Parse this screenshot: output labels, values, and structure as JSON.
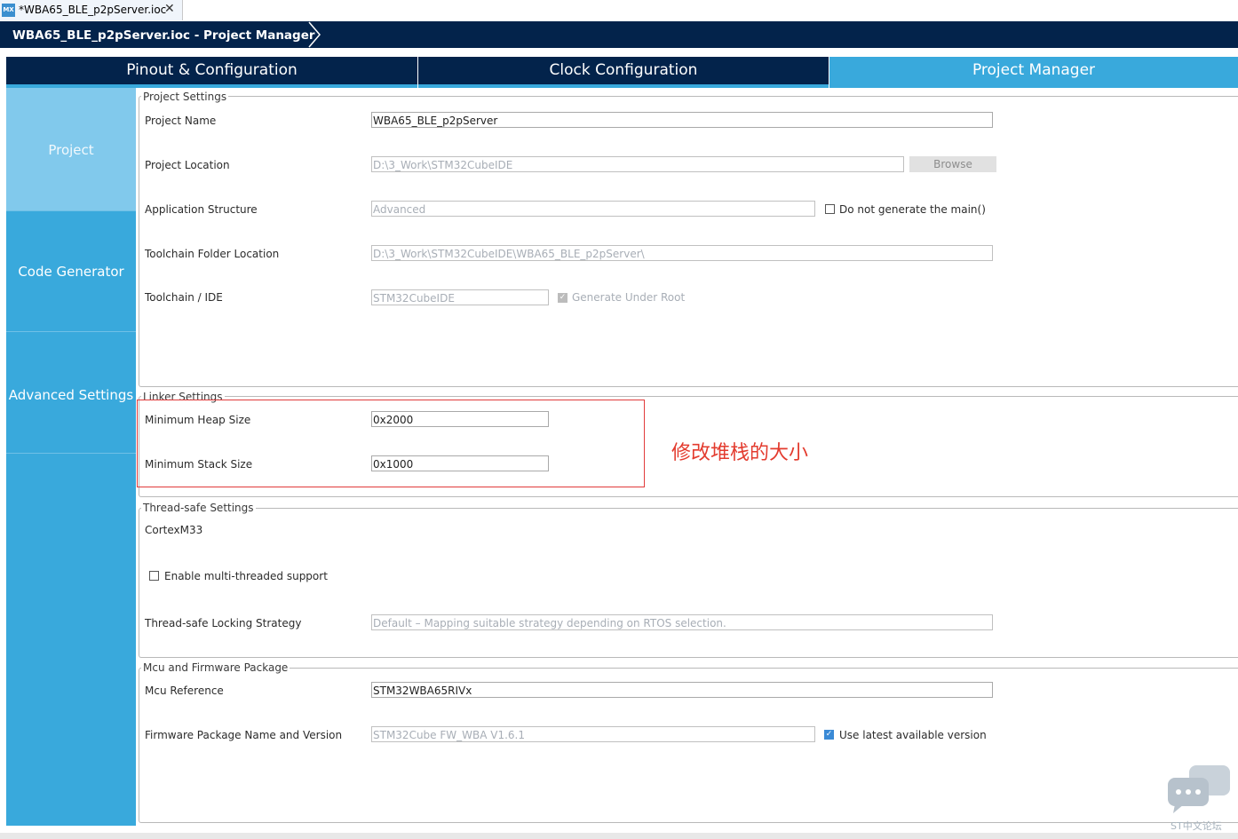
{
  "editor_tab": {
    "icon_text": "MX",
    "label": "*WBA65_BLE_p2pServer.ioc",
    "close_icon": "close-icon"
  },
  "breadcrumb": {
    "label": "WBA65_BLE_p2pServer.ioc - Project Manager",
    "icon": "chevron-right-icon"
  },
  "tabs": [
    {
      "label": "Pinout & Configuration",
      "active": false
    },
    {
      "label": "Clock Configuration",
      "active": false
    },
    {
      "label": "Project Manager",
      "active": true
    }
  ],
  "sidebar": {
    "items": [
      {
        "label": "Project",
        "active": true
      },
      {
        "label": "Code Generator",
        "active": false
      },
      {
        "label": "Advanced Settings",
        "active": false
      }
    ]
  },
  "project_settings": {
    "title": "Project Settings",
    "project_name_label": "Project Name",
    "project_name_value": "WBA65_BLE_p2pServer",
    "project_location_label": "Project Location",
    "project_location_value": "D:\\3_Work\\STM32CubeIDE",
    "browse_label": "Browse",
    "application_structure_label": "Application Structure",
    "application_structure_value": "Advanced",
    "no_main_label": "Do not generate the main()",
    "no_main_checked": false,
    "toolchain_folder_label": "Toolchain Folder Location",
    "toolchain_folder_value": "D:\\3_Work\\STM32CubeIDE\\WBA65_BLE_p2pServer\\",
    "toolchain_ide_label": "Toolchain / IDE",
    "toolchain_ide_value": "STM32CubeIDE",
    "generate_under_root_label": "Generate Under Root",
    "generate_under_root_checked": true
  },
  "linker_settings": {
    "title": "Linker Settings",
    "heap_label": "Minimum Heap Size",
    "heap_value": "0x2000",
    "stack_label": "Minimum Stack Size",
    "stack_value": "0x1000"
  },
  "annotation": {
    "text": "修改堆栈的大小",
    "color": "#e33b2e"
  },
  "thread_safe_settings": {
    "title": "Thread-safe Settings",
    "core_label": "CortexM33",
    "multithread_label": "Enable multi-threaded support",
    "multithread_checked": false,
    "locking_strategy_label": "Thread-safe Locking Strategy",
    "locking_strategy_value": "Default – Mapping suitable strategy depending on RTOS selection."
  },
  "mcu_firmware": {
    "title": "Mcu and Firmware Package",
    "mcu_reference_label": "Mcu Reference",
    "mcu_reference_value": "STM32WBA65RIVx",
    "firmware_label": "Firmware Package Name and Version",
    "firmware_value": "STM32Cube FW_WBA V1.6.1",
    "use_latest_label": "Use latest available version",
    "use_latest_checked": true
  },
  "watermark": {
    "text": "ST中文论坛",
    "icon": "chat-bubbles-icon"
  },
  "colors": {
    "navy": "#03234b",
    "accent_blue": "#39a9dc",
    "active_side": "#81c9ec",
    "highlight_red": "#e13b3b"
  }
}
